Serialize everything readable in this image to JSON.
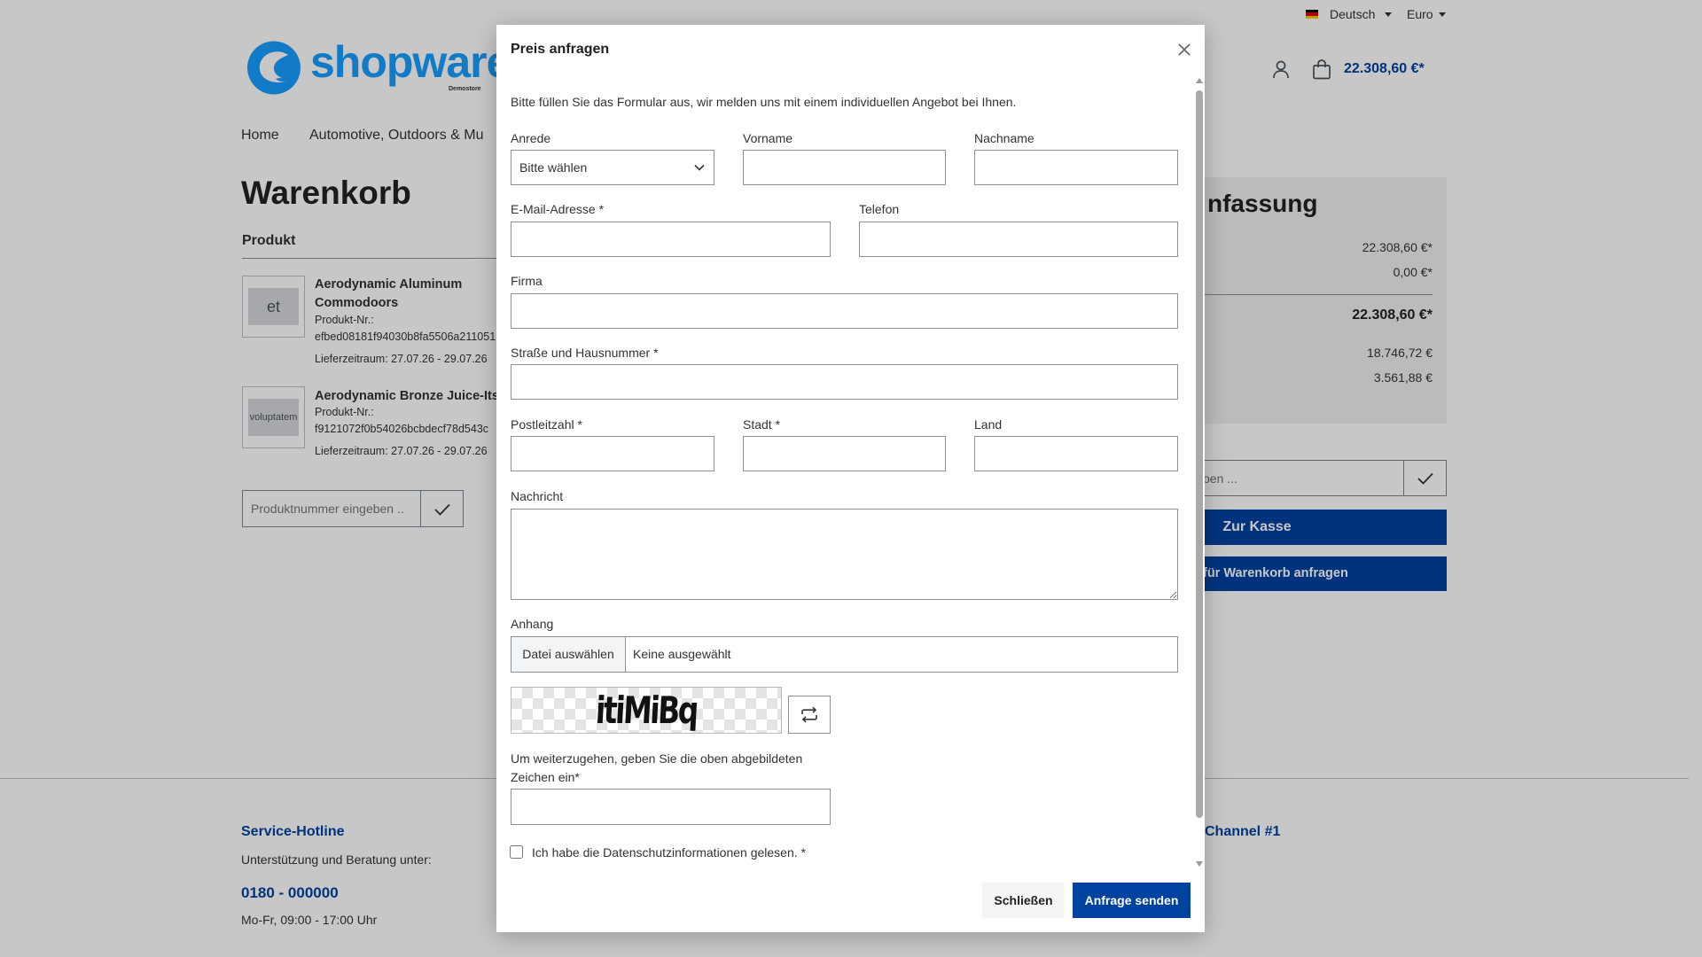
{
  "colors": {
    "primary": "#0042a0",
    "logo": "#189eff",
    "overlay": "rgba(0,0,0,0.22)"
  },
  "topbar": {
    "language": "Deutsch",
    "currency": "Euro",
    "icons": {
      "language": "german-flag-icon",
      "dropdown": "caret-down-icon"
    }
  },
  "header": {
    "logo_text": "shopware",
    "logo_subtext": "Demostore",
    "cart_total": "22.308,60 €*",
    "icons": {
      "account": "user-icon",
      "cart": "bag-icon"
    }
  },
  "nav": {
    "items": [
      "Home",
      "Automotive, Outdoors & Mu"
    ]
  },
  "cart": {
    "title": "Warenkorb",
    "column_header": "Produkt",
    "items": [
      {
        "image_text": "et",
        "title": "Aerodynamic Aluminum Commodoors",
        "number_label": "Produkt-Nr.:",
        "number": "efbed08181f94030b8fa5506a211051",
        "delivery": "Lieferzeitraum: 27.07.26 - 29.07.26"
      },
      {
        "image_text": "voluptatem",
        "title": "Aerodynamic Bronze Juice-Its",
        "number_label": "Produkt-Nr.:",
        "number": "f9121072f0b54026bcbdecf78d543c",
        "delivery": "Lieferzeitraum: 27.07.26 - 29.07.26"
      }
    ],
    "product_number_placeholder": "Produktnummer eingeben .."
  },
  "summary": {
    "heading": "nfassung",
    "subtotal": "22.308,60 €*",
    "shipping": "0,00 €*",
    "total": "22.308,60 €*",
    "net": "18.746,72 €",
    "tax": "3.561,88 €",
    "promo_placeholder": "ben ...",
    "checkout_label": "Zur Kasse",
    "quote_label": "für Warenkorb anfragen"
  },
  "footer": {
    "hotline_title": "Service-Hotline",
    "hotline_text": "Unterstützung und Beratung unter:",
    "hotline_phone": "0180 - 000000",
    "hotline_hours": "Mo-Fr, 09:00 - 17:00 Uhr",
    "channel_title": "Channel #1"
  },
  "modal": {
    "title": "Preis anfragen",
    "intro": "Bitte füllen Sie das Formular aus, wir melden uns mit einem individuellen Angebot bei Ihnen.",
    "fields": {
      "salutation": {
        "label": "Anrede",
        "selected": "Bitte wählen"
      },
      "first_name": {
        "label": "Vorname"
      },
      "last_name": {
        "label": "Nachname"
      },
      "email": {
        "label": "E-Mail-Adresse *"
      },
      "phone": {
        "label": "Telefon"
      },
      "company": {
        "label": "Firma"
      },
      "street": {
        "label": "Straße und Hausnummer *"
      },
      "zip": {
        "label": "Postleitzahl *"
      },
      "city": {
        "label": "Stadt *"
      },
      "country": {
        "label": "Land"
      },
      "message": {
        "label": "Nachricht"
      },
      "attachment": {
        "label": "Anhang",
        "button": "Datei auswählen",
        "status": "Keine ausgewählt"
      },
      "captcha": {
        "text": "itiMiBq",
        "instruction": "Um weiterzugehen, geben Sie die oben abgebildeten Zeichen ein*"
      },
      "privacy": {
        "label": "Ich habe die Datenschutzinformationen gelesen. *",
        "checked": false
      }
    },
    "buttons": {
      "close": "Schließen",
      "submit": "Anfrage senden"
    },
    "icons": {
      "close": "close-icon",
      "refresh": "refresh-icon",
      "select": "chevron-down-icon"
    }
  }
}
